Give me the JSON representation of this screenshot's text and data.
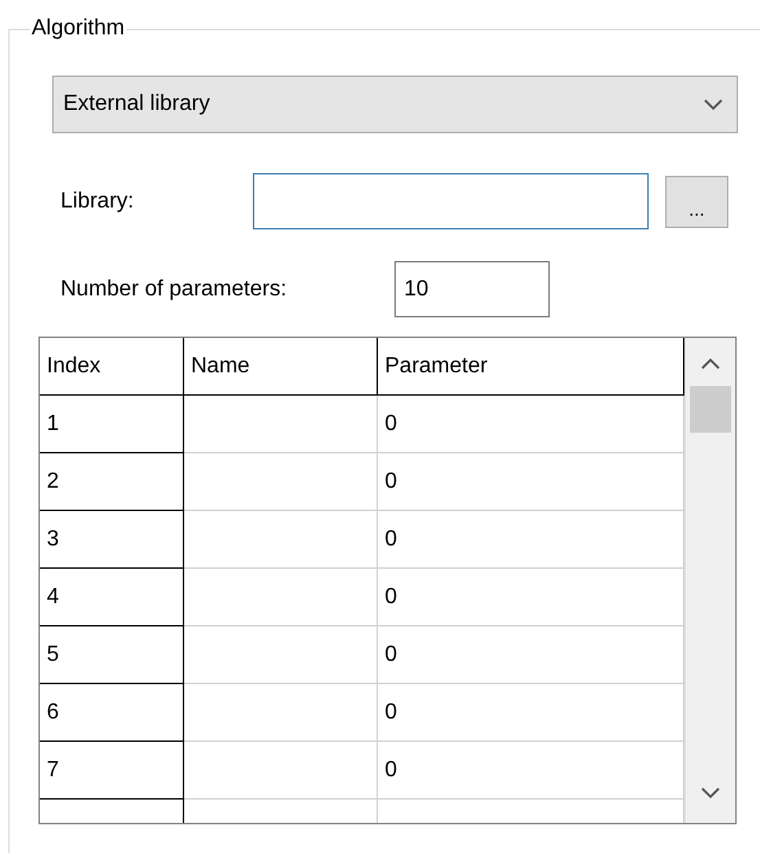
{
  "group": {
    "title": "Algorithm"
  },
  "algorithm_select": {
    "value": "External library"
  },
  "library": {
    "label": "Library:",
    "browse_button": "..."
  },
  "parameter_count": {
    "label": "Number of parameters:",
    "value": "10"
  },
  "table": {
    "columns": [
      "Index",
      "Name",
      "Parameter"
    ],
    "rows": [
      {
        "index": "1",
        "parameter": "0"
      },
      {
        "index": "2",
        "parameter": "0"
      },
      {
        "index": "3",
        "parameter": "0"
      },
      {
        "index": "4",
        "parameter": "0"
      },
      {
        "index": "5",
        "parameter": "0"
      },
      {
        "index": "6",
        "parameter": "0"
      },
      {
        "index": "7",
        "parameter": "0"
      }
    ]
  }
}
